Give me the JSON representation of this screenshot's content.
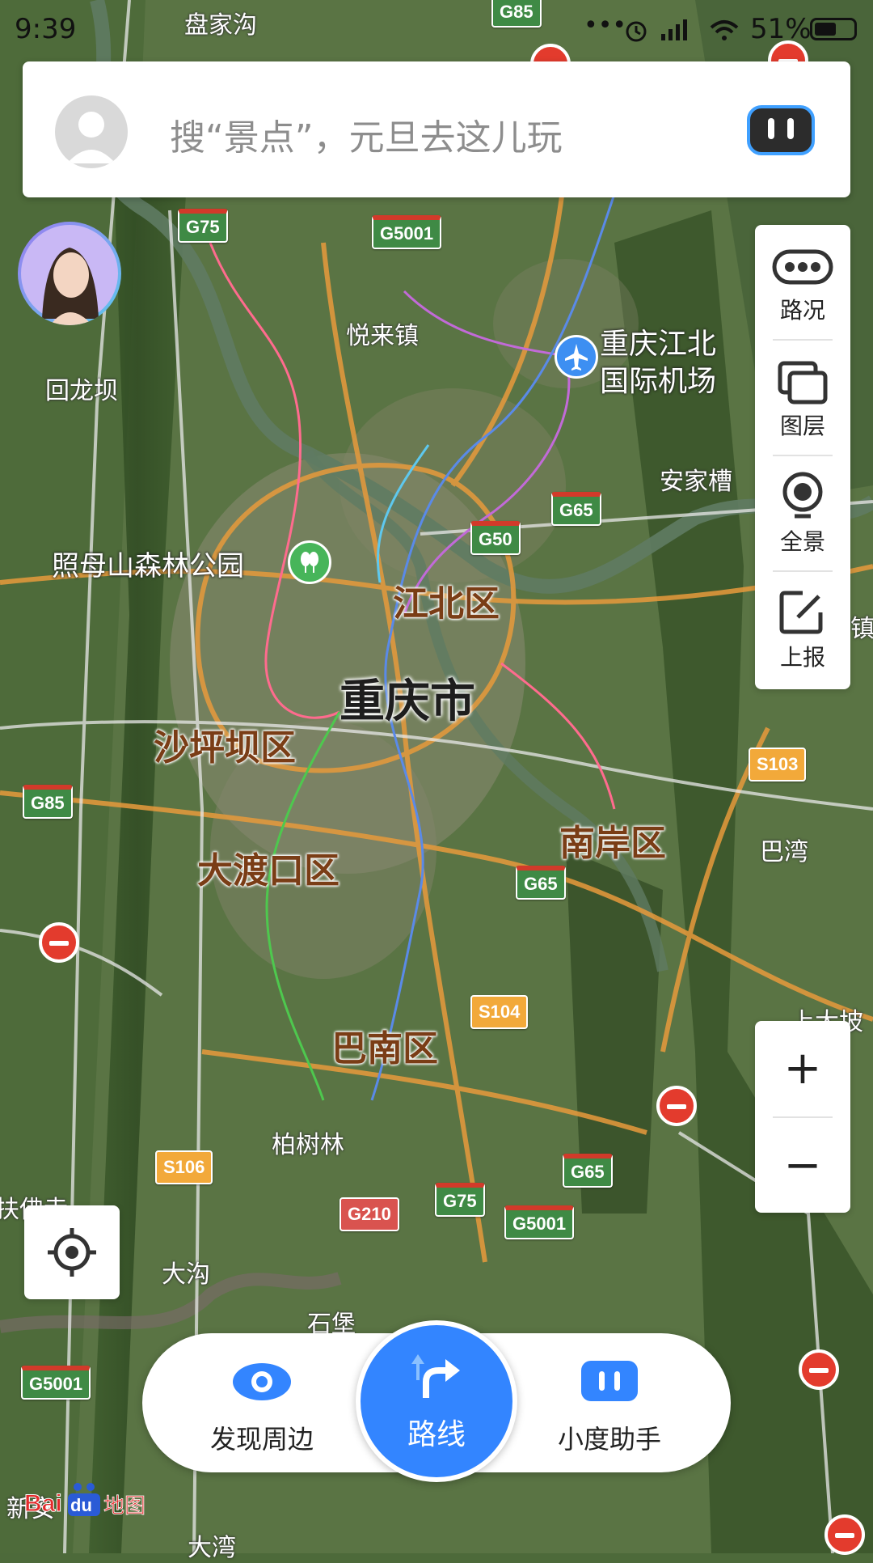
{
  "status_bar": {
    "time": "9:39",
    "battery": "51%"
  },
  "search": {
    "placeholder": "搜“景点”，元旦去这儿玩"
  },
  "tools": [
    {
      "label": "路况",
      "icon": "traffic-icon"
    },
    {
      "label": "图层",
      "icon": "layers-icon"
    },
    {
      "label": "全景",
      "icon": "panorama-icon"
    },
    {
      "label": "上报",
      "icon": "report-icon"
    }
  ],
  "zoom": {
    "in": "+",
    "out": "−"
  },
  "bottom_bar": {
    "discover": "发现周边",
    "route": "路线",
    "assistant": "小度助手"
  },
  "logo": {
    "text": "Baidu地图"
  },
  "map": {
    "city": "重庆市",
    "districts": [
      "江北区",
      "沙坪坝区",
      "大渡口区",
      "南岸区",
      "巴南区"
    ],
    "places": [
      "盘家沟",
      "悦来镇",
      "回龙坝",
      "安家槽",
      "巴湾",
      "柏树林",
      "大沟",
      "石堡",
      "上大坡",
      "镇",
      "大湾",
      "新安",
      "扶佛寺"
    ],
    "pois": [
      {
        "name": "重庆江北\n国际机场",
        "line1": "重庆江北",
        "line2": "国际机场",
        "icon": "airport-icon"
      },
      {
        "name": "照母山森林公园",
        "icon": "park-icon"
      }
    ],
    "highway_shields": [
      "G85",
      "G75",
      "G5001",
      "G65",
      "G50",
      "S103",
      "G85",
      "G65",
      "S104",
      "G65",
      "S106",
      "G210",
      "G75",
      "G5001",
      "G5001"
    ],
    "colors": {
      "national": "#3f8a45",
      "provincial": "#f2a93a",
      "route_blue": "#3385ff"
    }
  }
}
